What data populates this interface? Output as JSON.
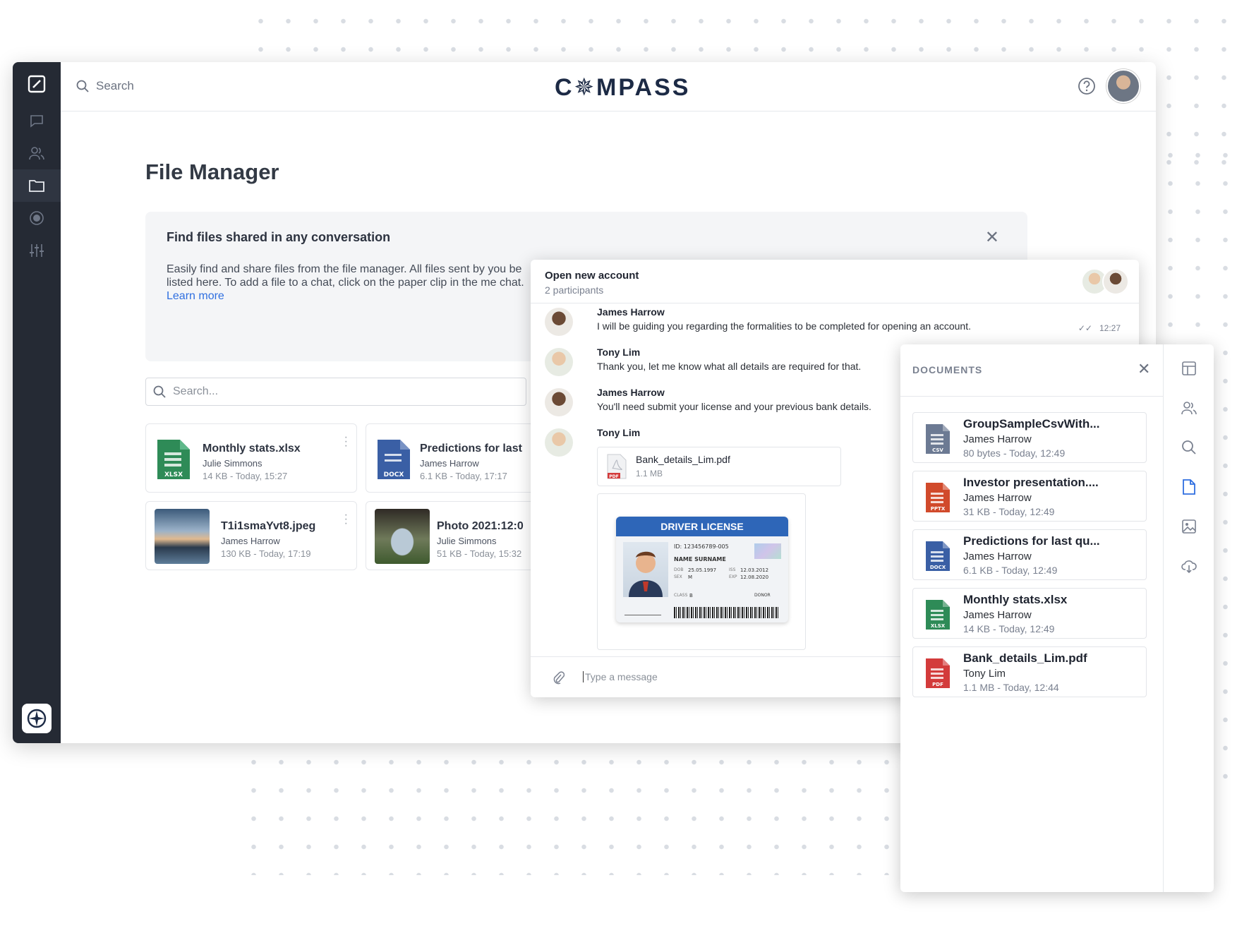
{
  "brand": {
    "name": "C✵MPASS"
  },
  "top_search": {
    "placeholder": "Search"
  },
  "page": {
    "title": "File Manager"
  },
  "banner": {
    "title": "Find files shared in any conversation",
    "text": "Easily find and share files from the file manager.  All files sent by you be listed here. To add a file to a chat, click on the paper clip in the me chat. ",
    "link": "Learn more"
  },
  "file_search": {
    "placeholder": "Search..."
  },
  "files": [
    {
      "name": "Monthly stats.xlsx",
      "owner": "Julie Simmons",
      "meta": "14 KB - Today, 15:27",
      "type": "XLSX",
      "color": "#2e8b57"
    },
    {
      "name": "Predictions for last",
      "owner": "James Harrow",
      "meta": "6.1 KB - Today, 17:17",
      "type": "DOCX",
      "color": "#3a5fa5"
    },
    {
      "name": "T1i1smaYvt8.jpeg",
      "owner": "James Harrow",
      "meta": "130 KB - Today, 17:19",
      "type": "IMG"
    },
    {
      "name": "Photo 2021:12:0",
      "owner": "Julie Simmons",
      "meta": "51 KB - Today, 15:32",
      "type": "IMG"
    }
  ],
  "chat": {
    "title": "Open new account",
    "subtitle": "2 participants",
    "messages": [
      {
        "author": "James Harrow",
        "text": "I will be guiding you regarding the formalities to be completed for opening an account.",
        "time": "12:27"
      },
      {
        "author": "Tony Lim",
        "text": "Thank you, let me know what all details are required for that."
      },
      {
        "author": "James Harrow",
        "text": "You'll need submit your license and your previous bank details."
      },
      {
        "author": "Tony Lim",
        "attachment": {
          "name": "Bank_details_Lim.pdf",
          "size": "1.1 MB"
        }
      }
    ],
    "license": {
      "header": "DRIVER LICENSE",
      "id": "ID: 123456789-005",
      "name": "NAME SURNAME",
      "dob_label": "DOB",
      "dob": "25.05.1997",
      "sex_label": "SEX",
      "sex": "M",
      "iss_label": "ISS",
      "iss": "12.03.2012",
      "exp_label": "EXP",
      "exp": "12.08.2020",
      "class_label": "CLASS",
      "class": "B",
      "donor": "DONOR"
    },
    "input_placeholder": "Type a message"
  },
  "documents": {
    "title": "DOCUMENTS",
    "items": [
      {
        "name": "GroupSampleCsvWith...",
        "owner": "James Harrow",
        "meta": "80 bytes - Today, 12:49",
        "type": "CSV",
        "color": "#6c7a93"
      },
      {
        "name": "Investor presentation....",
        "owner": "James Harrow",
        "meta": "31 KB - Today, 12:49",
        "type": "PPTX",
        "color": "#d14a2b"
      },
      {
        "name": "Predictions for last qu...",
        "owner": "James Harrow",
        "meta": "6.1 KB - Today, 12:49",
        "type": "DOCX",
        "color": "#3a5fa5"
      },
      {
        "name": "Monthly stats.xlsx",
        "owner": "James Harrow",
        "meta": "14 KB - Today, 12:49",
        "type": "XLSX",
        "color": "#2e8b57"
      },
      {
        "name": "Bank_details_Lim.pdf",
        "owner": "Tony Lim",
        "meta": "1.1 MB - Today, 12:44",
        "type": "PDF",
        "color": "#d33b3b"
      }
    ]
  },
  "colors": {
    "rail": "#252a34",
    "accent": "#2f6fe0",
    "brand": "#1c2a45"
  }
}
